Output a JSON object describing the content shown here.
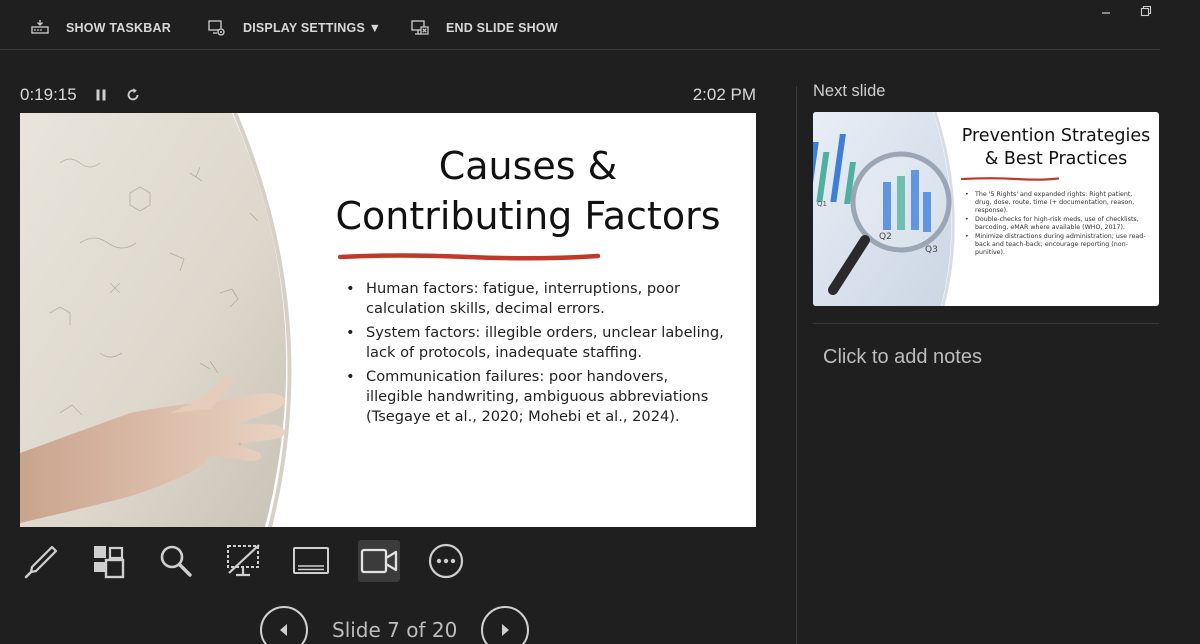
{
  "toolbar": {
    "show_taskbar": "SHOW TASKBAR",
    "display_settings": "DISPLAY SETTINGS ▼",
    "end_slide_show": "END SLIDE SHOW"
  },
  "timer": {
    "elapsed": "0:19:15",
    "clock": "2:02 PM"
  },
  "current_slide": {
    "title_line1": "Causes &",
    "title_line2": "Contributing Factors",
    "bullets": [
      "Human factors: fatigue, interruptions, poor calculation skills, decimal errors.",
      "System factors: illegible orders, unclear labeling, lack of protocols, inadequate staffing.",
      "Communication failures: poor handovers, illegible handwriting, ambiguous abbreviations (Tsegaye et al., 2020; Mohebi et al., 2024)."
    ],
    "accent_color": "#c0392b"
  },
  "navigation": {
    "counter": "Slide 7 of 20"
  },
  "next_slide": {
    "label": "Next slide",
    "title_line1": "Prevention Strategies",
    "title_line2": "& Best Practices",
    "chart_labels": [
      "Q1",
      "Q2",
      "Q3"
    ],
    "bullets": [
      "The '5 Rights' and expanded rights: Right patient, drug, dose, route, time (+ documentation, reason, response).",
      "Double-checks for high-risk meds, use of checklists, barcoding, eMAR where available (WHO, 2017).",
      "Minimize distractions during administration; use read-back and teach-back; encourage reporting (non-punitive)."
    ]
  },
  "notes": {
    "placeholder": "Click to add notes"
  },
  "icons": {
    "taskbar": "taskbar-icon",
    "display": "display-settings-icon",
    "end": "end-show-icon",
    "pause": "pause-icon",
    "restart": "restart-icon",
    "pen": "pen-icon",
    "all_slides": "see-all-slides-icon",
    "zoom": "zoom-icon",
    "black_screen": "black-screen-icon",
    "subtitles": "subtitles-icon",
    "camera": "camera-icon",
    "more": "more-options-icon",
    "prev": "previous-arrow-icon",
    "next": "next-arrow-icon"
  }
}
